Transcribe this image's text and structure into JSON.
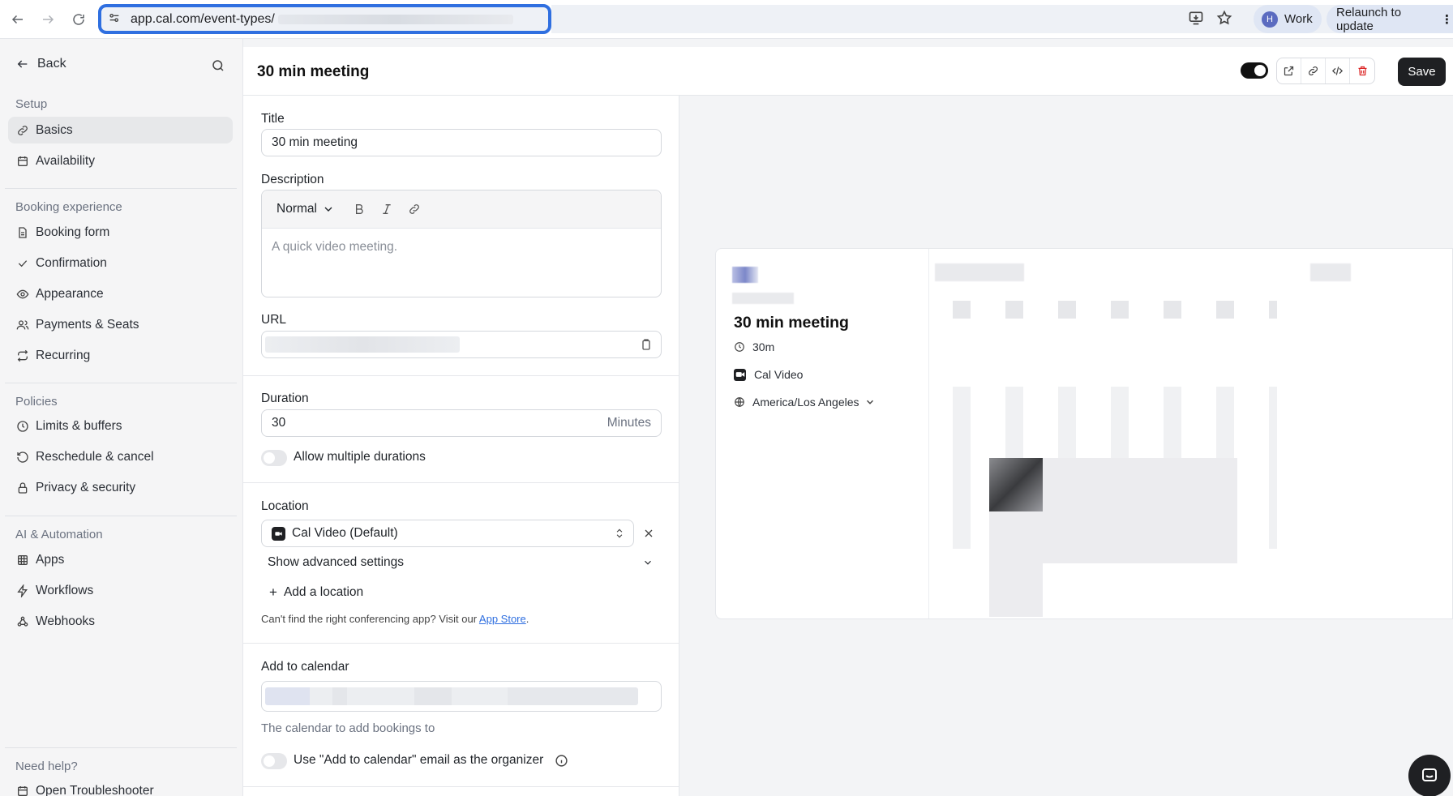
{
  "browser": {
    "url": "app.cal.com/event-types/",
    "profile_label": "Work",
    "profile_initial": "H",
    "relaunch_label": "Relaunch to update"
  },
  "sidebar": {
    "back_label": "Back",
    "sections": [
      {
        "title": "Setup",
        "items": [
          {
            "label": "Basics",
            "icon": "link-icon",
            "active": true
          },
          {
            "label": "Availability",
            "icon": "calendar-icon"
          }
        ]
      },
      {
        "title": "Booking experience",
        "items": [
          {
            "label": "Booking form",
            "icon": "file-icon"
          },
          {
            "label": "Confirmation",
            "icon": "check-icon"
          },
          {
            "label": "Appearance",
            "icon": "eye-icon"
          },
          {
            "label": "Payments & Seats",
            "icon": "users-icon"
          },
          {
            "label": "Recurring",
            "icon": "repeat-icon"
          }
        ]
      },
      {
        "title": "Policies",
        "items": [
          {
            "label": "Limits & buffers",
            "icon": "clock-icon"
          },
          {
            "label": "Reschedule & cancel",
            "icon": "rotate-icon"
          },
          {
            "label": "Privacy & security",
            "icon": "lock-icon"
          }
        ]
      },
      {
        "title": "AI & Automation",
        "items": [
          {
            "label": "Apps",
            "icon": "grid-icon"
          },
          {
            "label": "Workflows",
            "icon": "zap-icon"
          },
          {
            "label": "Webhooks",
            "icon": "webhook-icon"
          }
        ]
      },
      {
        "title": "Need help?",
        "items": [
          {
            "label": "Open Troubleshooter",
            "icon": "calendar-icon"
          }
        ]
      }
    ]
  },
  "header": {
    "title": "30 min meeting",
    "save_label": "Save"
  },
  "form": {
    "title_label": "Title",
    "title_value": "30 min meeting",
    "description_label": "Description",
    "format_label": "Normal",
    "description_placeholder": "A quick video meeting.",
    "url_label": "URL",
    "duration_label": "Duration",
    "duration_value": "30",
    "duration_unit": "Minutes",
    "multi_duration_label": "Allow multiple durations",
    "location_label": "Location",
    "location_value": "Cal Video (Default)",
    "advanced_label": "Show advanced settings",
    "add_location_label": "Add a location",
    "conferencing_note": "Can't find the right conferencing app? Visit our ",
    "app_store_label": "App Store",
    "calendar_label": "Add to calendar",
    "calendar_hint": "The calendar to add bookings to",
    "organizer_email_label": "Use \"Add to calendar\" email as the organizer"
  },
  "preview": {
    "title": "30 min meeting",
    "duration": "30m",
    "location": "Cal Video",
    "timezone": "America/Los Angeles"
  }
}
